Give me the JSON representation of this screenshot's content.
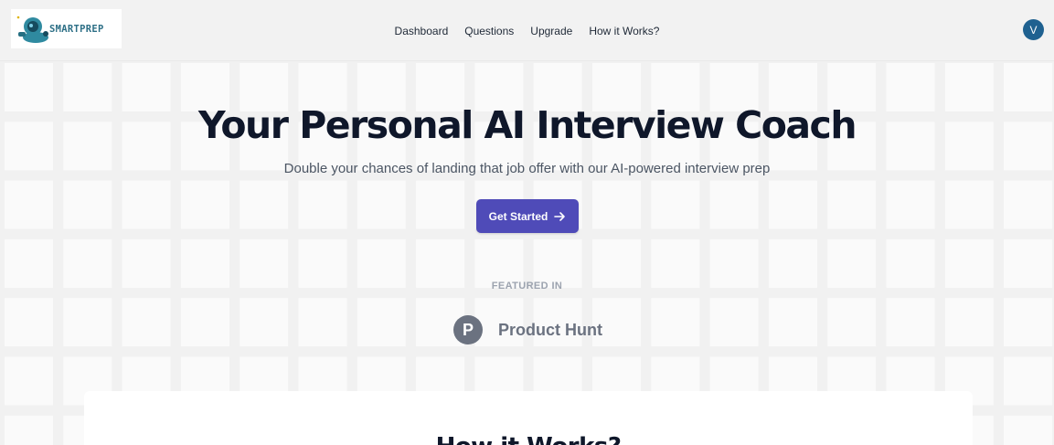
{
  "header": {
    "logo_text": "SMARTPREP",
    "nav": [
      "Dashboard",
      "Questions",
      "Upgrade",
      "How it Works?"
    ],
    "avatar_initial": "V"
  },
  "hero": {
    "title": "Your Personal AI Interview Coach",
    "subtitle": "Double your chances of landing that job offer with our AI-powered interview prep",
    "cta_label": "Get Started",
    "featured_label": "FEATURED IN",
    "product_hunt_letter": "P",
    "product_hunt_label": "Product Hunt"
  },
  "how_section": {
    "title": "How it Works?"
  },
  "colors": {
    "accent": "#4f4bb8",
    "avatar": "#1f6190",
    "logo": "#2d6f86"
  }
}
